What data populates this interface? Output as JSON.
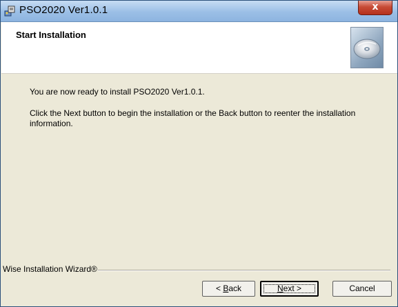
{
  "window": {
    "title": "PSO2020 Ver1.0.1",
    "close_label": "x"
  },
  "header": {
    "title": "Start Installation"
  },
  "body": {
    "line1": "You are now ready to install PSO2020 Ver1.0.1.",
    "line2": "Click the Next button to begin the installation or the Back button to reenter the installation information."
  },
  "footer": {
    "group_label": "Wise Installation Wizard®"
  },
  "buttons": {
    "back_underlined": "B",
    "back_rest": "ack",
    "back_prefix": "< ",
    "next_underlined": "N",
    "next_rest": "ext",
    "next_suffix": " >",
    "cancel": "Cancel"
  },
  "icons": {
    "app": "installer-app-icon",
    "header": "cd-disc-icon"
  }
}
